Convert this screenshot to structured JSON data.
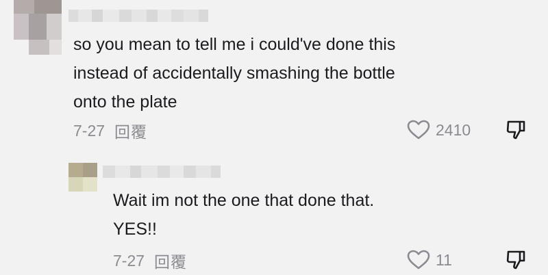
{
  "comments": [
    {
      "text": "so you mean to tell me i could've done this\ninstead of accidentally smashing the bottle\nonto the plate",
      "date": "7-27",
      "reply_label": "回覆",
      "like_count": "2410",
      "like_icon": "heart-outline-icon",
      "dislike_icon": "thumbs-down-icon"
    },
    {
      "text": "Wait im not the one that done that.\nYES!!",
      "date": "7-27",
      "reply_label": "回覆",
      "like_count": "11",
      "like_icon": "heart-outline-icon",
      "dislike_icon": "thumbs-down-icon"
    }
  ],
  "colors": {
    "background": "#f2f2f2",
    "text": "#1b1b1f",
    "meta": "#8a8b91"
  }
}
